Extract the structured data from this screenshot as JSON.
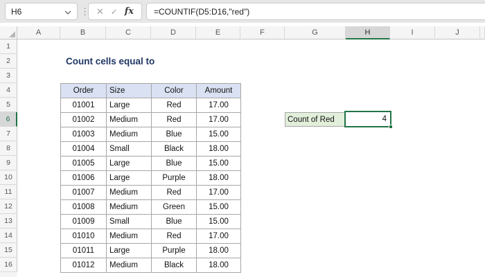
{
  "formula_bar": {
    "cell_ref": "H6",
    "cancel_icon": "✕",
    "confirm_icon": "✓",
    "fx_icon": "fx",
    "formula": "=COUNTIF(D5:D16,\"red\")"
  },
  "sheet": {
    "columns": [
      "A",
      "B",
      "C",
      "D",
      "E",
      "F",
      "G",
      "H",
      "I",
      "J"
    ],
    "selected_column": "H",
    "rows": [
      "1",
      "2",
      "3",
      "4",
      "5",
      "6",
      "7",
      "8",
      "9",
      "10",
      "11",
      "12",
      "13",
      "14",
      "15",
      "16"
    ],
    "selected_row": "6"
  },
  "content": {
    "title": "Count cells equal to",
    "table": {
      "headers": [
        "Order",
        "Size",
        "Color",
        "Amount"
      ],
      "rows": [
        {
          "order": "01001",
          "size": "Large",
          "color": "Red",
          "amount": "17.00"
        },
        {
          "order": "01002",
          "size": "Medium",
          "color": "Red",
          "amount": "17.00"
        },
        {
          "order": "01003",
          "size": "Medium",
          "color": "Blue",
          "amount": "15.00"
        },
        {
          "order": "01004",
          "size": "Small",
          "color": "Black",
          "amount": "18.00"
        },
        {
          "order": "01005",
          "size": "Large",
          "color": "Blue",
          "amount": "15.00"
        },
        {
          "order": "01006",
          "size": "Large",
          "color": "Purple",
          "amount": "18.00"
        },
        {
          "order": "01007",
          "size": "Medium",
          "color": "Red",
          "amount": "17.00"
        },
        {
          "order": "01008",
          "size": "Medium",
          "color": "Green",
          "amount": "15.00"
        },
        {
          "order": "01009",
          "size": "Small",
          "color": "Blue",
          "amount": "15.00"
        },
        {
          "order": "01010",
          "size": "Medium",
          "color": "Red",
          "amount": "17.00"
        },
        {
          "order": "01011",
          "size": "Large",
          "color": "Purple",
          "amount": "18.00"
        },
        {
          "order": "01012",
          "size": "Medium",
          "color": "Black",
          "amount": "18.00"
        }
      ]
    },
    "result": {
      "label": "Count of Red",
      "value": "4"
    }
  },
  "colors": {
    "selection_green": "#217346",
    "table_header_fill": "#D9E1F2",
    "result_label_fill": "#E2EFDA",
    "title_color": "#203764"
  }
}
